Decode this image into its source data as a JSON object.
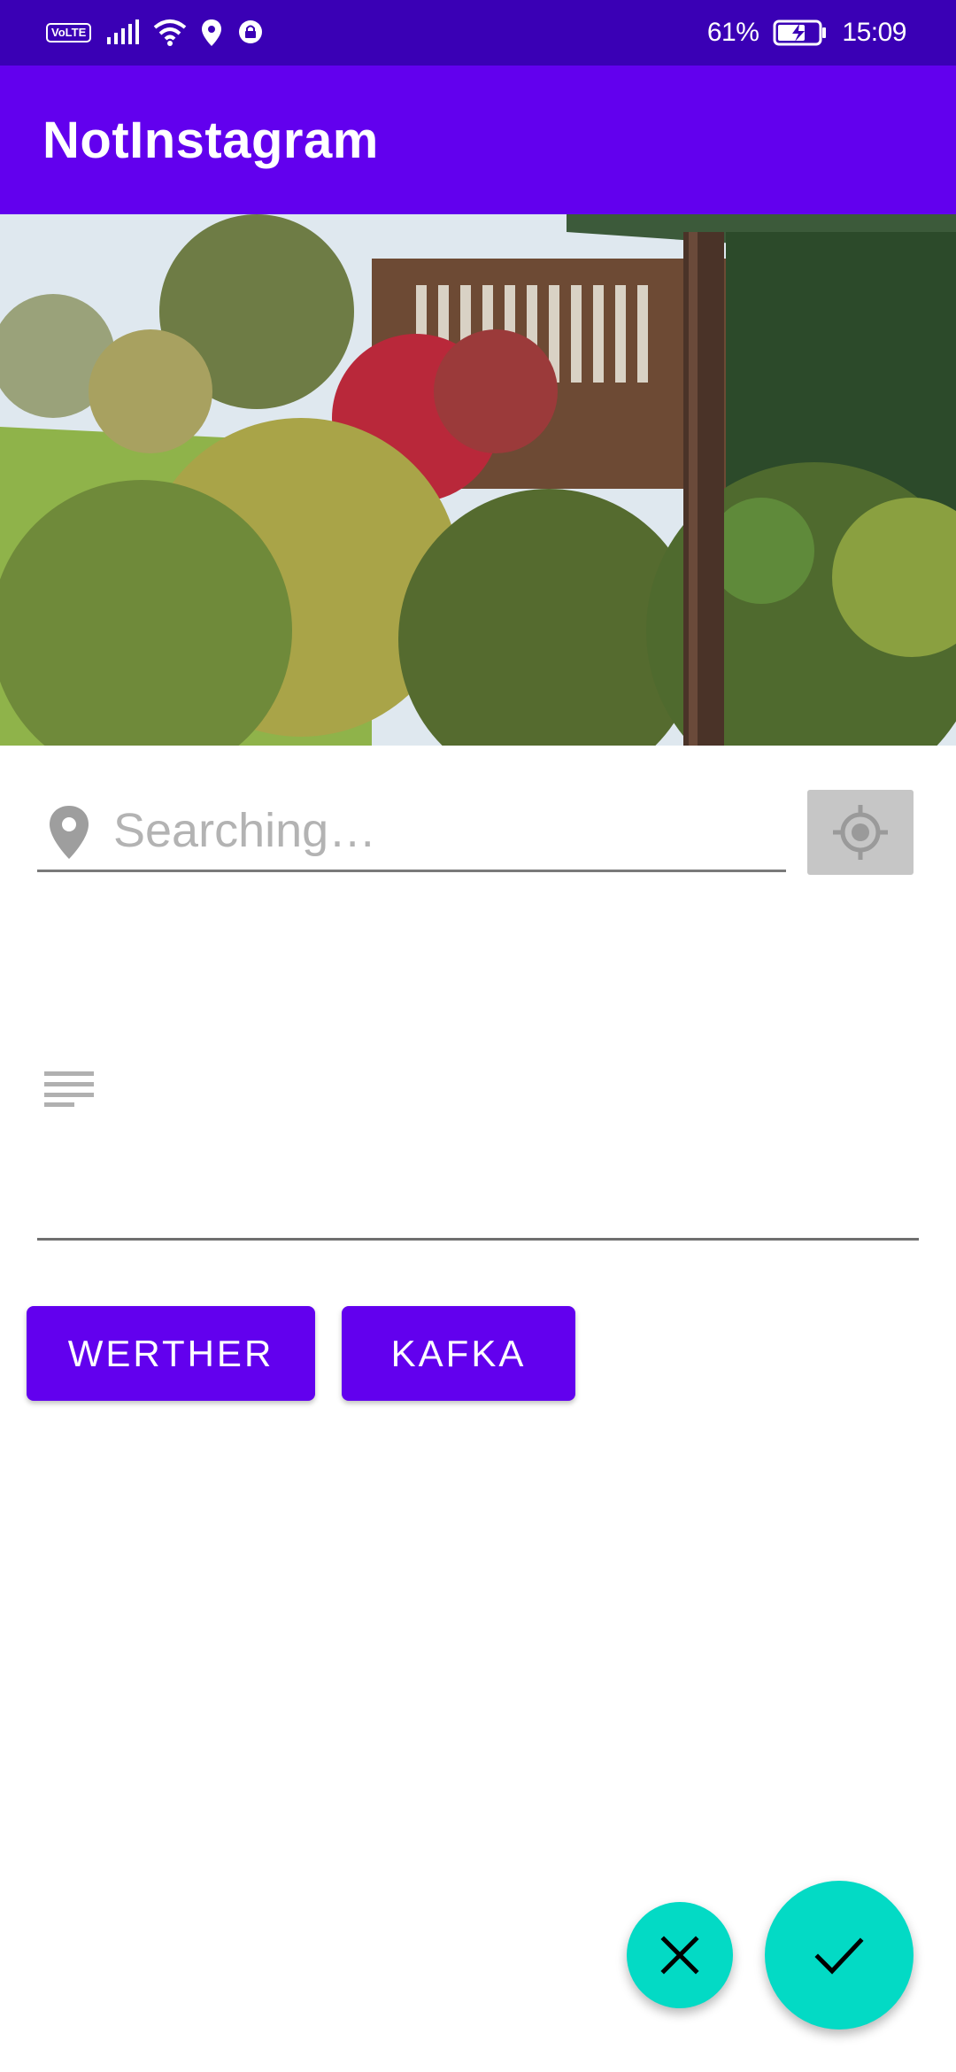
{
  "status_bar": {
    "network_badge": "VoLTE",
    "battery_percent": "61%",
    "time": "15:09",
    "icons": [
      "volte-icon",
      "signal-icon",
      "wifi-icon",
      "location-icon",
      "vpn-lock-icon",
      "battery-charging-icon"
    ]
  },
  "app_bar": {
    "title": "NotInstagram"
  },
  "photo": {
    "description_icon": "photo-preview"
  },
  "location": {
    "placeholder": "Searching…",
    "value": "",
    "icon": "location-pin-icon",
    "gps_button_icon": "gps-target-icon"
  },
  "description": {
    "icon": "notes-icon",
    "value": ""
  },
  "tags": [
    {
      "label": "WERTHER"
    },
    {
      "label": "KAFKA"
    }
  ],
  "actions": {
    "cancel_icon": "close-icon",
    "confirm_icon": "check-icon"
  },
  "colors": {
    "status_bar": "#3a00b5",
    "primary": "#6200ee",
    "secondary": "#03dac5",
    "disabled": "#c6c6c6"
  }
}
